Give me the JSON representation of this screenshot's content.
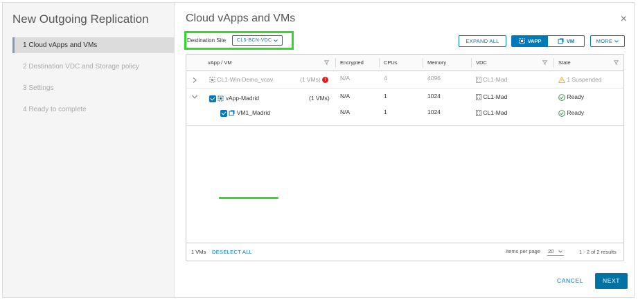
{
  "wizard": {
    "title": "New Outgoing Replication"
  },
  "steps": [
    {
      "label": "1  Cloud vApps and VMs",
      "state": "active"
    },
    {
      "label": "2  Destination VDC and Storage policy",
      "state": "inactive"
    },
    {
      "label": "3  Settings",
      "state": "inactive"
    },
    {
      "label": "4  Ready to complete",
      "state": "inactive"
    }
  ],
  "page": {
    "title": "Cloud vApps and VMs",
    "close": "×"
  },
  "destination": {
    "label": "Destination Site",
    "value": "CL5-BCN-VDC"
  },
  "toolbar": {
    "expand_all": "EXPAND ALL",
    "vapp": "VAPP",
    "vm": "VM",
    "more": "MORE"
  },
  "grid": {
    "columns": [
      "vApp / VM",
      "Encrypted",
      "CPUs",
      "Memory",
      "VDC",
      "State"
    ],
    "rows": [
      {
        "name": "CL1-Win-Demo_vcav",
        "vms": "(1 VMs)",
        "encrypted": "N/A",
        "cpus": "4",
        "memory": "4096",
        "vdc": "CL1-Mad",
        "state": "1 Suspended"
      },
      {
        "name": "vApp-Madrid",
        "vms": "(1 VMs)",
        "encrypted": "N/A",
        "cpus": "1",
        "memory": "1024",
        "vdc": "CL1-Mad",
        "state": "Ready"
      },
      {
        "name": "VM1_Madrid",
        "vms": "",
        "encrypted": "N/A",
        "cpus": "1",
        "memory": "1024",
        "vdc": "CL1-Mad",
        "state": "Ready"
      }
    ],
    "footer": {
      "selected": "1 VMs",
      "deselect": "DESELECT ALL",
      "ipp_label": "Items per page",
      "ipp_value": "20",
      "range": "1 - 2 of 2 results"
    }
  },
  "actions": {
    "cancel": "CANCEL",
    "next": "NEXT"
  },
  "colors": {
    "accent": "#0079b8",
    "highlight": "#2fdc25",
    "warning": "#f5a623",
    "ok": "#2e8540",
    "error": "#e02020"
  }
}
